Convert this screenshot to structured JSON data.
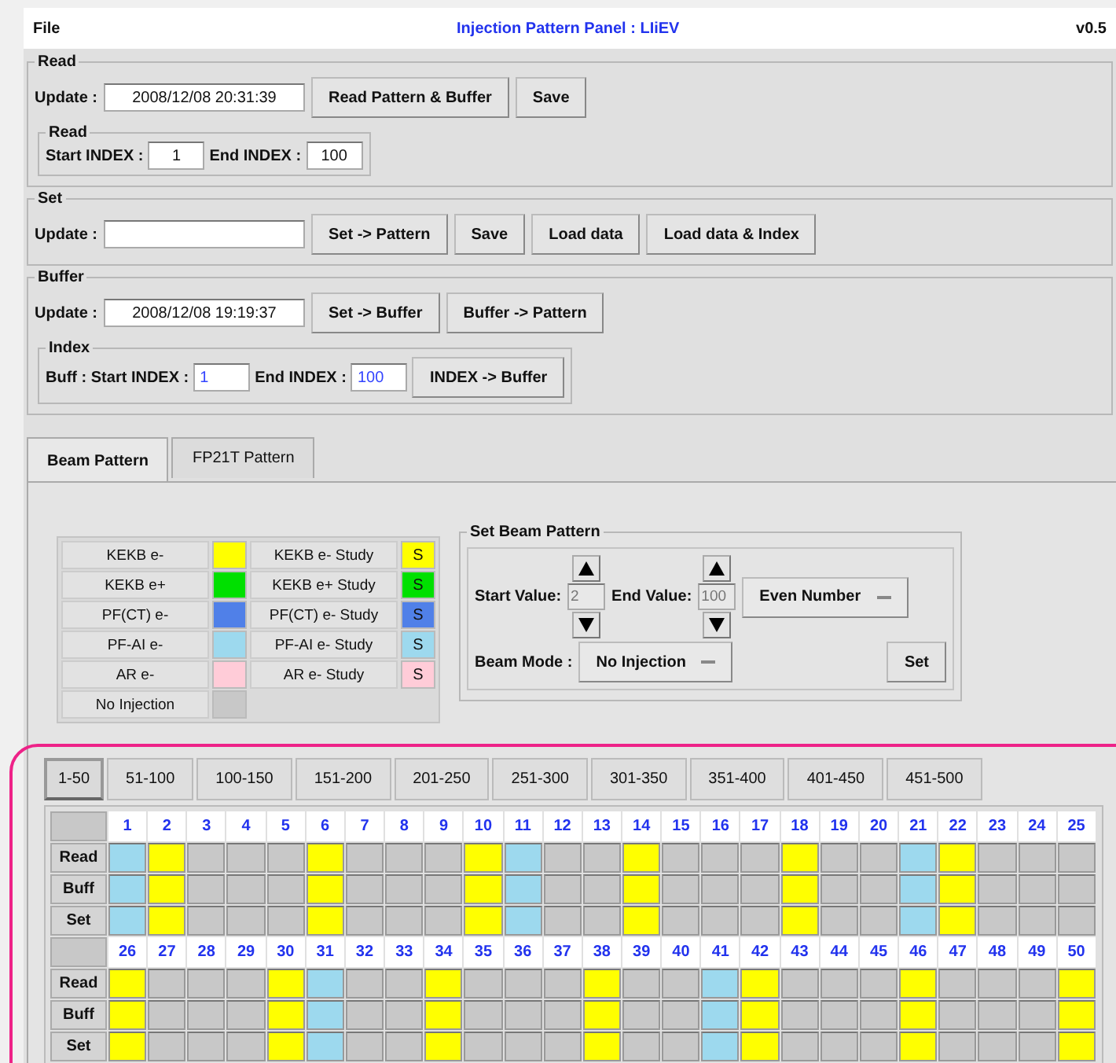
{
  "menu": {
    "items": [
      "File"
    ],
    "title": "Injection Pattern Panel : LIiEV",
    "version": "v0.5"
  },
  "read": {
    "title": "Read",
    "update_label": "Update :",
    "update_value": "2008/12/08 20:31:39",
    "buttons": [
      "Read Pattern & Buffer",
      "Save"
    ],
    "range": {
      "title": "Read",
      "start_label": "Start INDEX :",
      "start_value": "1",
      "end_label": "End INDEX :",
      "end_value": "100"
    }
  },
  "set": {
    "title": "Set",
    "update_label": "Update :",
    "buttons": [
      "Set -> Pattern",
      "Save",
      "Load data",
      "Load data & Index"
    ]
  },
  "buffer": {
    "title": "Buffer",
    "update_label": "Update :",
    "update_value": "2008/12/08 19:19:37",
    "buttons": [
      "Set -> Buffer",
      "Buffer -> Pattern"
    ],
    "index": {
      "title": "Index",
      "start_label": "Buff : Start INDEX :",
      "start_value": "1",
      "end_label": "End INDEX :",
      "end_value": "100",
      "button": "INDEX -> Buffer"
    }
  },
  "tabs": [
    {
      "label": "Beam Pattern",
      "selected": true
    },
    {
      "label": "FP21T Pattern",
      "selected": false
    }
  ],
  "legend": [
    {
      "label": "KEKB e-",
      "color": "#ffff00",
      "study_label": "KEKB e- Study",
      "study_mark": "S"
    },
    {
      "label": "KEKB e+",
      "color": "#00e000",
      "study_label": "KEKB e+ Study",
      "study_mark": "S"
    },
    {
      "label": "PF(CT) e-",
      "color": "#5080e8",
      "study_label": "PF(CT) e- Study",
      "study_mark": "S"
    },
    {
      "label": "PF-AI e-",
      "color": "#9dd9ee",
      "study_label": "PF-AI e- Study",
      "study_mark": "S"
    },
    {
      "label": "AR e-",
      "color": "#ffccd8",
      "study_label": "AR e- Study",
      "study_mark": "S"
    },
    {
      "label": "No Injection",
      "color": "#c8c8c8"
    }
  ],
  "set_beam_pattern": {
    "title": "Set Beam Pattern",
    "start_label": "Start Value:",
    "start_value": "2",
    "end_label": "End Value:",
    "end_value": "100",
    "mode_select": "Even Number",
    "beam_mode_label": "Beam Mode :",
    "beam_mode": "No Injection",
    "button": "Set"
  },
  "range_tabs": [
    {
      "label": "1-50",
      "selected": true
    },
    {
      "label": "51-100",
      "selected": false
    },
    {
      "label": "100-150",
      "selected": false
    },
    {
      "label": "151-200",
      "selected": false
    },
    {
      "label": "201-250",
      "selected": false
    },
    {
      "label": "251-300",
      "selected": false
    },
    {
      "label": "301-350",
      "selected": false
    },
    {
      "label": "351-400",
      "selected": false
    },
    {
      "label": "401-450",
      "selected": false
    },
    {
      "label": "451-500",
      "selected": false
    }
  ],
  "grid": {
    "blocks": [
      {
        "row_labels": [
          "Read",
          "Buff",
          "Set"
        ],
        "slots": [
          {
            "label": "1",
            "cells": [
              {
                "color": "#9dd9ee"
              },
              {
                "color": "#9dd9ee"
              },
              {
                "color": "#9dd9ee"
              }
            ]
          },
          {
            "label": "2",
            "cells": [
              {
                "color": "#ffff00"
              },
              {
                "color": "#ffff00"
              },
              {
                "color": "#ffff00"
              }
            ]
          },
          {
            "label": "3",
            "cells": [
              {
                "color": "#c8c8c8"
              },
              {
                "color": "#c8c8c8"
              },
              {
                "color": "#c8c8c8"
              }
            ]
          },
          {
            "label": "4",
            "cells": [
              {
                "color": "#c8c8c8"
              },
              {
                "color": "#c8c8c8"
              },
              {
                "color": "#c8c8c8"
              }
            ]
          },
          {
            "label": "5",
            "cells": [
              {
                "color": "#c8c8c8"
              },
              {
                "color": "#c8c8c8"
              },
              {
                "color": "#c8c8c8"
              }
            ]
          },
          {
            "label": "6",
            "cells": [
              {
                "color": "#ffff00"
              },
              {
                "color": "#ffff00"
              },
              {
                "color": "#ffff00"
              }
            ]
          },
          {
            "label": "7",
            "cells": [
              {
                "color": "#c8c8c8"
              },
              {
                "color": "#c8c8c8"
              },
              {
                "color": "#c8c8c8"
              }
            ]
          },
          {
            "label": "8",
            "cells": [
              {
                "color": "#c8c8c8"
              },
              {
                "color": "#c8c8c8"
              },
              {
                "color": "#c8c8c8"
              }
            ]
          },
          {
            "label": "9",
            "cells": [
              {
                "color": "#c8c8c8"
              },
              {
                "color": "#c8c8c8"
              },
              {
                "color": "#c8c8c8"
              }
            ]
          },
          {
            "label": "10",
            "cells": [
              {
                "color": "#ffff00"
              },
              {
                "color": "#ffff00"
              },
              {
                "color": "#ffff00"
              }
            ]
          },
          {
            "label": "11",
            "cells": [
              {
                "color": "#9dd9ee"
              },
              {
                "color": "#9dd9ee"
              },
              {
                "color": "#9dd9ee"
              }
            ]
          },
          {
            "label": "12",
            "cells": [
              {
                "color": "#c8c8c8"
              },
              {
                "color": "#c8c8c8"
              },
              {
                "color": "#c8c8c8"
              }
            ]
          },
          {
            "label": "13",
            "cells": [
              {
                "color": "#c8c8c8"
              },
              {
                "color": "#c8c8c8"
              },
              {
                "color": "#c8c8c8"
              }
            ]
          },
          {
            "label": "14",
            "cells": [
              {
                "color": "#ffff00"
              },
              {
                "color": "#ffff00"
              },
              {
                "color": "#ffff00"
              }
            ]
          },
          {
            "label": "15",
            "cells": [
              {
                "color": "#c8c8c8"
              },
              {
                "color": "#c8c8c8"
              },
              {
                "color": "#c8c8c8"
              }
            ]
          },
          {
            "label": "16",
            "cells": [
              {
                "color": "#c8c8c8"
              },
              {
                "color": "#c8c8c8"
              },
              {
                "color": "#c8c8c8"
              }
            ]
          },
          {
            "label": "17",
            "cells": [
              {
                "color": "#c8c8c8"
              },
              {
                "color": "#c8c8c8"
              },
              {
                "color": "#c8c8c8"
              }
            ]
          },
          {
            "label": "18",
            "cells": [
              {
                "color": "#ffff00"
              },
              {
                "color": "#ffff00"
              },
              {
                "color": "#ffff00"
              }
            ]
          },
          {
            "label": "19",
            "cells": [
              {
                "color": "#c8c8c8"
              },
              {
                "color": "#c8c8c8"
              },
              {
                "color": "#c8c8c8"
              }
            ]
          },
          {
            "label": "20",
            "cells": [
              {
                "color": "#c8c8c8"
              },
              {
                "color": "#c8c8c8"
              },
              {
                "color": "#c8c8c8"
              }
            ]
          },
          {
            "label": "21",
            "cells": [
              {
                "color": "#9dd9ee"
              },
              {
                "color": "#9dd9ee"
              },
              {
                "color": "#9dd9ee"
              }
            ]
          },
          {
            "label": "22",
            "cells": [
              {
                "color": "#ffff00"
              },
              {
                "color": "#ffff00"
              },
              {
                "color": "#ffff00"
              }
            ]
          },
          {
            "label": "23",
            "cells": [
              {
                "color": "#c8c8c8"
              },
              {
                "color": "#c8c8c8"
              },
              {
                "color": "#c8c8c8"
              }
            ]
          },
          {
            "label": "24",
            "cells": [
              {
                "color": "#c8c8c8"
              },
              {
                "color": "#c8c8c8"
              },
              {
                "color": "#c8c8c8"
              }
            ]
          },
          {
            "label": "25",
            "cells": [
              {
                "color": "#c8c8c8"
              },
              {
                "color": "#c8c8c8"
              },
              {
                "color": "#c8c8c8"
              }
            ]
          }
        ]
      },
      {
        "row_labels": [
          "Read",
          "Buff",
          "Set"
        ],
        "slots": [
          {
            "label": "26",
            "cells": [
              {
                "color": "#ffff00"
              },
              {
                "color": "#ffff00"
              },
              {
                "color": "#ffff00"
              }
            ]
          },
          {
            "label": "27",
            "cells": [
              {
                "color": "#c8c8c8"
              },
              {
                "color": "#c8c8c8"
              },
              {
                "color": "#c8c8c8"
              }
            ]
          },
          {
            "label": "28",
            "cells": [
              {
                "color": "#c8c8c8"
              },
              {
                "color": "#c8c8c8"
              },
              {
                "color": "#c8c8c8"
              }
            ]
          },
          {
            "label": "29",
            "cells": [
              {
                "color": "#c8c8c8"
              },
              {
                "color": "#c8c8c8"
              },
              {
                "color": "#c8c8c8"
              }
            ]
          },
          {
            "label": "30",
            "cells": [
              {
                "color": "#ffff00"
              },
              {
                "color": "#ffff00"
              },
              {
                "color": "#ffff00"
              }
            ]
          },
          {
            "label": "31",
            "cells": [
              {
                "color": "#9dd9ee"
              },
              {
                "color": "#9dd9ee"
              },
              {
                "color": "#9dd9ee"
              }
            ]
          },
          {
            "label": "32",
            "cells": [
              {
                "color": "#c8c8c8"
              },
              {
                "color": "#c8c8c8"
              },
              {
                "color": "#c8c8c8"
              }
            ]
          },
          {
            "label": "33",
            "cells": [
              {
                "color": "#c8c8c8"
              },
              {
                "color": "#c8c8c8"
              },
              {
                "color": "#c8c8c8"
              }
            ]
          },
          {
            "label": "34",
            "cells": [
              {
                "color": "#ffff00"
              },
              {
                "color": "#ffff00"
              },
              {
                "color": "#ffff00"
              }
            ]
          },
          {
            "label": "35",
            "cells": [
              {
                "color": "#c8c8c8"
              },
              {
                "color": "#c8c8c8"
              },
              {
                "color": "#c8c8c8"
              }
            ]
          },
          {
            "label": "36",
            "cells": [
              {
                "color": "#c8c8c8"
              },
              {
                "color": "#c8c8c8"
              },
              {
                "color": "#c8c8c8"
              }
            ]
          },
          {
            "label": "37",
            "cells": [
              {
                "color": "#c8c8c8"
              },
              {
                "color": "#c8c8c8"
              },
              {
                "color": "#c8c8c8"
              }
            ]
          },
          {
            "label": "38",
            "cells": [
              {
                "color": "#ffff00"
              },
              {
                "color": "#ffff00"
              },
              {
                "color": "#ffff00"
              }
            ]
          },
          {
            "label": "39",
            "cells": [
              {
                "color": "#c8c8c8"
              },
              {
                "color": "#c8c8c8"
              },
              {
                "color": "#c8c8c8"
              }
            ]
          },
          {
            "label": "40",
            "cells": [
              {
                "color": "#c8c8c8"
              },
              {
                "color": "#c8c8c8"
              },
              {
                "color": "#c8c8c8"
              }
            ]
          },
          {
            "label": "41",
            "cells": [
              {
                "color": "#9dd9ee"
              },
              {
                "color": "#9dd9ee"
              },
              {
                "color": "#9dd9ee"
              }
            ]
          },
          {
            "label": "42",
            "cells": [
              {
                "color": "#ffff00"
              },
              {
                "color": "#ffff00"
              },
              {
                "color": "#ffff00"
              }
            ]
          },
          {
            "label": "43",
            "cells": [
              {
                "color": "#c8c8c8"
              },
              {
                "color": "#c8c8c8"
              },
              {
                "color": "#c8c8c8"
              }
            ]
          },
          {
            "label": "44",
            "cells": [
              {
                "color": "#c8c8c8"
              },
              {
                "color": "#c8c8c8"
              },
              {
                "color": "#c8c8c8"
              }
            ]
          },
          {
            "label": "45",
            "cells": [
              {
                "color": "#c8c8c8"
              },
              {
                "color": "#c8c8c8"
              },
              {
                "color": "#c8c8c8"
              }
            ]
          },
          {
            "label": "46",
            "cells": [
              {
                "color": "#ffff00"
              },
              {
                "color": "#ffff00"
              },
              {
                "color": "#ffff00"
              }
            ]
          },
          {
            "label": "47",
            "cells": [
              {
                "color": "#c8c8c8"
              },
              {
                "color": "#c8c8c8"
              },
              {
                "color": "#c8c8c8"
              }
            ]
          },
          {
            "label": "48",
            "cells": [
              {
                "color": "#c8c8c8"
              },
              {
                "color": "#c8c8c8"
              },
              {
                "color": "#c8c8c8"
              }
            ]
          },
          {
            "label": "49",
            "cells": [
              {
                "color": "#c8c8c8"
              },
              {
                "color": "#c8c8c8"
              },
              {
                "color": "#c8c8c8"
              }
            ]
          },
          {
            "label": "50",
            "cells": [
              {
                "color": "#ffff00"
              },
              {
                "color": "#ffff00"
              },
              {
                "color": "#ffff00"
              }
            ]
          }
        ]
      }
    ]
  }
}
